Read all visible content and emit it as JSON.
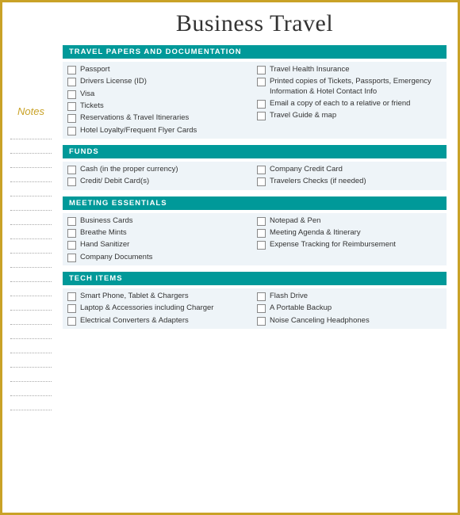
{
  "title": "Business Travel",
  "sidebar": {
    "notes_label": "Notes",
    "note_line_count": 20
  },
  "sections": [
    {
      "id": "travel-papers",
      "header": "TRAVEL PAPERS AND DOCUMENTATION",
      "left_items": [
        "Passport",
        "Drivers License (ID)",
        "Visa",
        "Tickets",
        "Reservations & Travel Itineraries",
        "Hotel Loyalty/Frequent Flyer Cards"
      ],
      "right_items": [
        "Travel Health Insurance",
        "Printed copies of Tickets, Passports, Emergency Information & Hotel Contact Info",
        "Email a copy of each to a relative or friend",
        "Travel Guide & map"
      ]
    },
    {
      "id": "funds",
      "header": "FUNDS",
      "left_items": [
        "Cash (in the proper currency)",
        "Credit/ Debit Card(s)"
      ],
      "right_items": [
        "Company Credit Card",
        "Travelers Checks (if needed)"
      ]
    },
    {
      "id": "meeting-essentials",
      "header": "MEETING ESSENTIALS",
      "left_items": [
        "Business Cards",
        "Breathe Mints",
        "Hand Sanitizer",
        "Company Documents"
      ],
      "right_items": [
        "Notepad & Pen",
        "Meeting Agenda & Itinerary",
        "Expense Tracking for Reimbursement"
      ]
    },
    {
      "id": "tech-items",
      "header": "TECH ITEMS",
      "left_items": [
        "Smart Phone, Tablet & Chargers",
        "Laptop & Accessories including Charger",
        "Electrical Converters & Adapters"
      ],
      "right_items": [
        "Flash Drive",
        "A Portable Backup",
        "Noise Canceling Headphones"
      ]
    }
  ]
}
